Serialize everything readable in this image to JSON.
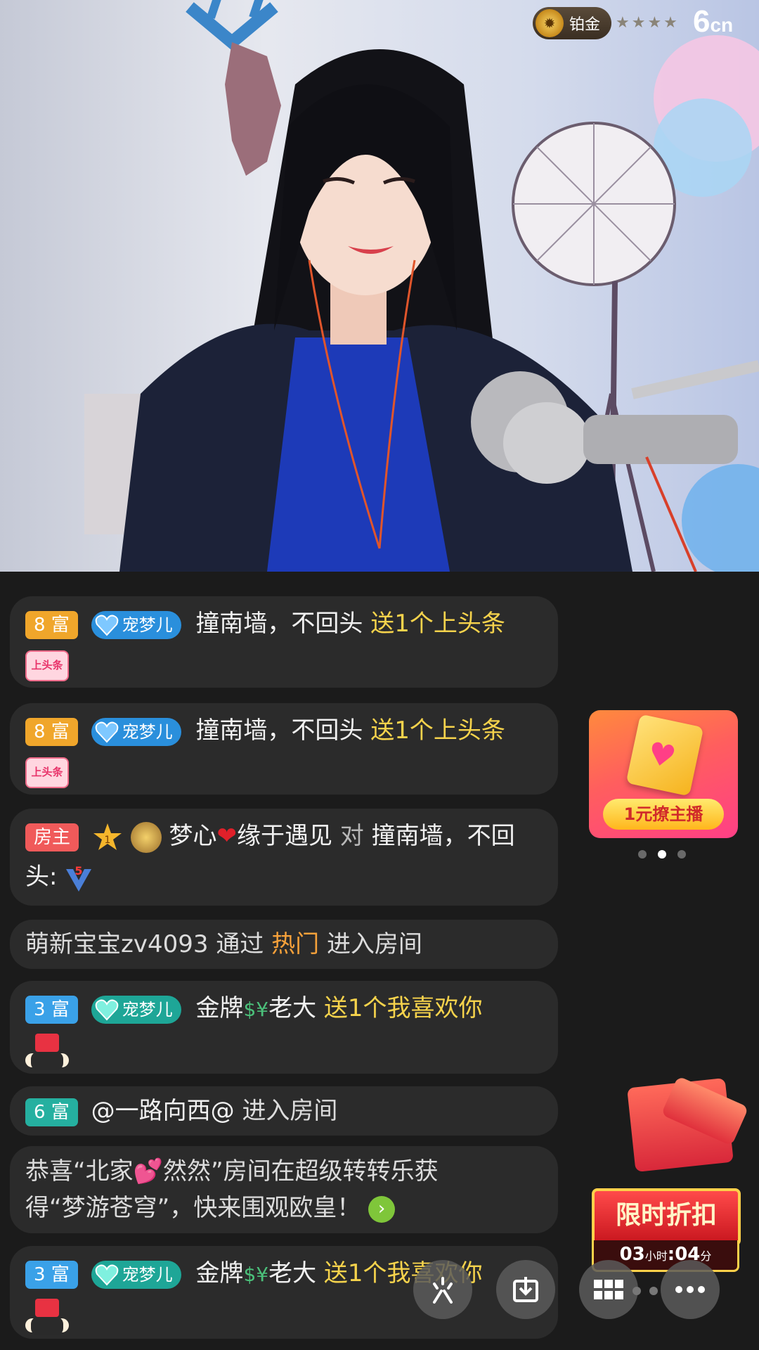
{
  "stream": {
    "badge_text": "铂金",
    "stars": "★★★★",
    "logo_main": "6",
    "logo_suffix": "cn"
  },
  "chat": [
    {
      "level": "8 富",
      "level_color": "gold",
      "pet": "宠梦儿",
      "pet_color": "blue",
      "pet_num": "2",
      "user": "撞南墙，不回头",
      "action": "送1个上头条",
      "gift": "上头条"
    },
    {
      "level": "8 富",
      "level_color": "gold",
      "pet": "宠梦儿",
      "pet_color": "blue",
      "pet_num": "2",
      "user": "撞南墙，不回头",
      "action": "送1个上头条",
      "gift": "上头条"
    },
    {
      "role": "房主",
      "star_num": "1",
      "sender_a": "梦心",
      "sender_b": "缘于遇见",
      "to_word": "对",
      "target": "撞南墙，不回头:",
      "v_level": "5"
    },
    {
      "user": "萌新宝宝zv4093",
      "via": "通过",
      "source": "热门",
      "enter": "进入房间"
    },
    {
      "level": "3 富",
      "level_color": "blue",
      "pet": "宠梦儿",
      "pet_color": "teal",
      "pet_num": "1",
      "user_a": "金牌",
      "user_b": "老大",
      "action": "送1个我喜欢你"
    },
    {
      "level": "6 富",
      "level_color": "teal",
      "user": "@一路向西@",
      "enter": "进入房间"
    },
    {
      "line1_a": "恭喜“北家",
      "line1_b": "然然”房间在超级转转乐获",
      "line2": "得“梦游苍穹”，快来围观欧皇！"
    },
    {
      "level": "3 富",
      "level_color": "blue",
      "pet": "宠梦儿",
      "pet_color": "teal",
      "pet_num": "1",
      "user_a": "金牌",
      "user_b": "老大",
      "action": "送1个我喜欢你"
    }
  ],
  "promo": {
    "label": "1元撩主播",
    "page_active": 2,
    "page_count": 3
  },
  "discount": {
    "title": "限时折扣",
    "hours": "03",
    "hours_unit": "小时",
    "minutes": "04",
    "minutes_unit": "分"
  },
  "controls": [
    "share-icon",
    "download-icon",
    "grid-icon",
    "more-icon"
  ]
}
